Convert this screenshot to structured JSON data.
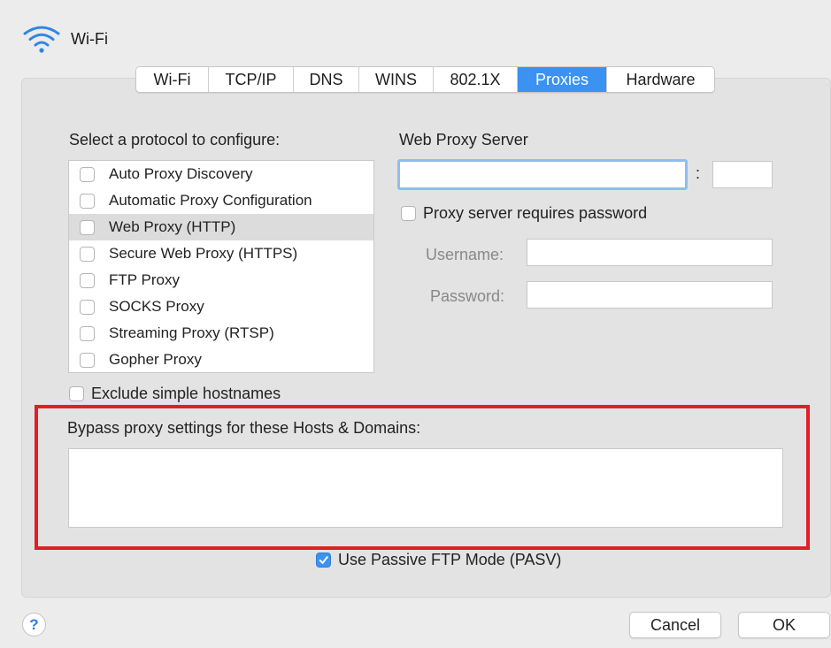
{
  "window": {
    "title": "Wi-Fi",
    "icon": "wifi-icon"
  },
  "tabs": [
    {
      "label": "Wi-Fi",
      "active": false
    },
    {
      "label": "TCP/IP",
      "active": false
    },
    {
      "label": "DNS",
      "active": false
    },
    {
      "label": "WINS",
      "active": false
    },
    {
      "label": "802.1X",
      "active": false
    },
    {
      "label": "Proxies",
      "active": true
    },
    {
      "label": "Hardware",
      "active": false
    }
  ],
  "protocols": {
    "heading": "Select a protocol to configure:",
    "items": [
      {
        "label": "Auto Proxy Discovery",
        "checked": false,
        "selected": false
      },
      {
        "label": "Automatic Proxy Configuration",
        "checked": false,
        "selected": false
      },
      {
        "label": "Web Proxy (HTTP)",
        "checked": false,
        "selected": true
      },
      {
        "label": "Secure Web Proxy (HTTPS)",
        "checked": false,
        "selected": false
      },
      {
        "label": "FTP Proxy",
        "checked": false,
        "selected": false
      },
      {
        "label": "SOCKS Proxy",
        "checked": false,
        "selected": false
      },
      {
        "label": "Streaming Proxy (RTSP)",
        "checked": false,
        "selected": false
      },
      {
        "label": "Gopher Proxy",
        "checked": false,
        "selected": false
      }
    ]
  },
  "proxy_server": {
    "heading": "Web Proxy Server",
    "server_value": "",
    "separator": ":",
    "port_value": "",
    "requires_password_label": "Proxy server requires password",
    "requires_password_checked": false,
    "username_label": "Username:",
    "username_value": "",
    "password_label": "Password:",
    "password_value": ""
  },
  "exclude_simple": {
    "label": "Exclude simple hostnames",
    "checked": false
  },
  "bypass": {
    "heading": "Bypass proxy settings for these Hosts & Domains:",
    "value": ""
  },
  "passive_ftp": {
    "label": "Use Passive FTP Mode (PASV)",
    "checked": true
  },
  "footer": {
    "help_label": "?",
    "cancel_label": "Cancel",
    "ok_label": "OK"
  },
  "colors": {
    "accent": "#3b92f0",
    "highlight": "#e01f26",
    "background": "#ececec"
  }
}
